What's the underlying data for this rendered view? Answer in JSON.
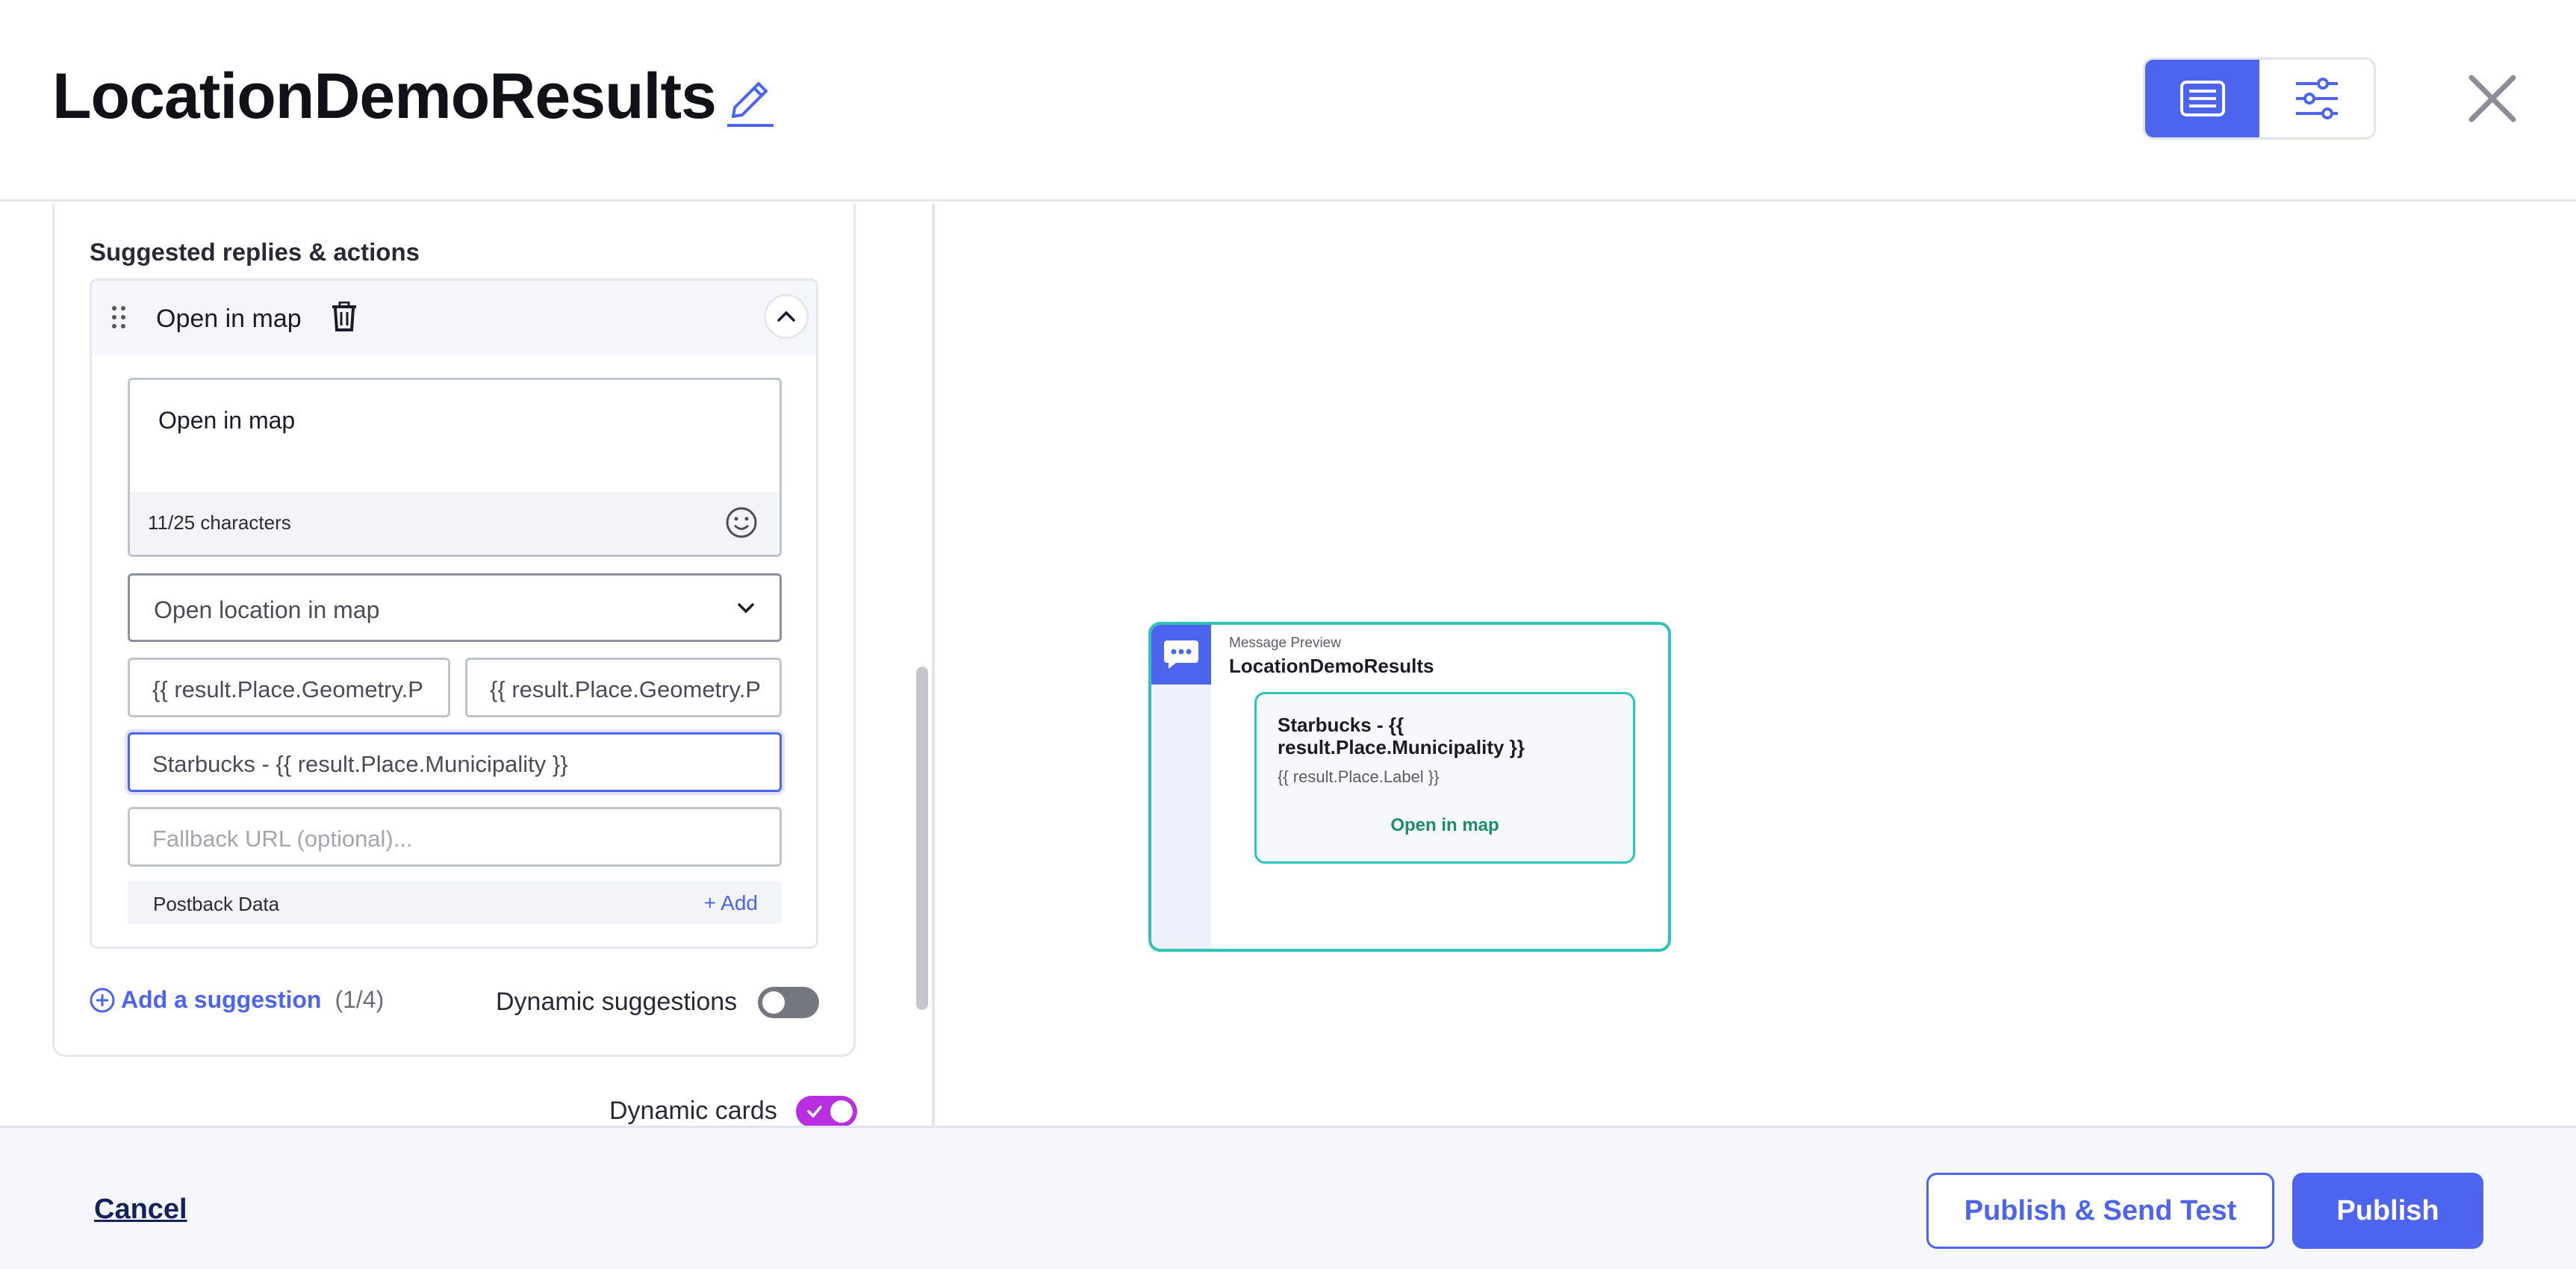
{
  "header": {
    "title": "LocationDemoResults",
    "edit_icon": "pencil-icon",
    "view_toggle": {
      "active": "preview",
      "icons": [
        "message-list-icon",
        "sliders-icon"
      ]
    },
    "close_icon": "close-icon"
  },
  "editor": {
    "section_label": "Suggested replies & actions",
    "suggestion": {
      "title": "Open in map",
      "text_value": "Open in map",
      "char_count": "11/25 characters",
      "action_type": "Open location in map",
      "latitude": "{{ result.Place.Geometry.P",
      "longitude": "{{ result.Place.Geometry.P",
      "label": "Starbucks - {{ result.Place.Municipality }}",
      "fallback_placeholder": "Fallback URL (optional)...",
      "postback_label": "Postback Data",
      "postback_add": "+ Add"
    },
    "add_suggestion": "Add a suggestion",
    "suggestion_count": "(1/4)",
    "dynamic_suggestions": {
      "label": "Dynamic suggestions",
      "enabled": false
    },
    "dynamic_cards": {
      "label": "Dynamic cards",
      "enabled": true
    }
  },
  "preview": {
    "label": "Message Preview",
    "title": "LocationDemoResults",
    "card": {
      "title": "Starbucks - {{ result.Place.Municipality }}",
      "description": "{{ result.Place.Label }}",
      "action": "Open in map"
    }
  },
  "footer": {
    "cancel": "Cancel",
    "publish_test": "Publish & Send Test",
    "publish": "Publish"
  },
  "colors": {
    "accent": "#4c64ee",
    "teal": "#2ec4b6",
    "toggle_on": "#b92ee0"
  }
}
